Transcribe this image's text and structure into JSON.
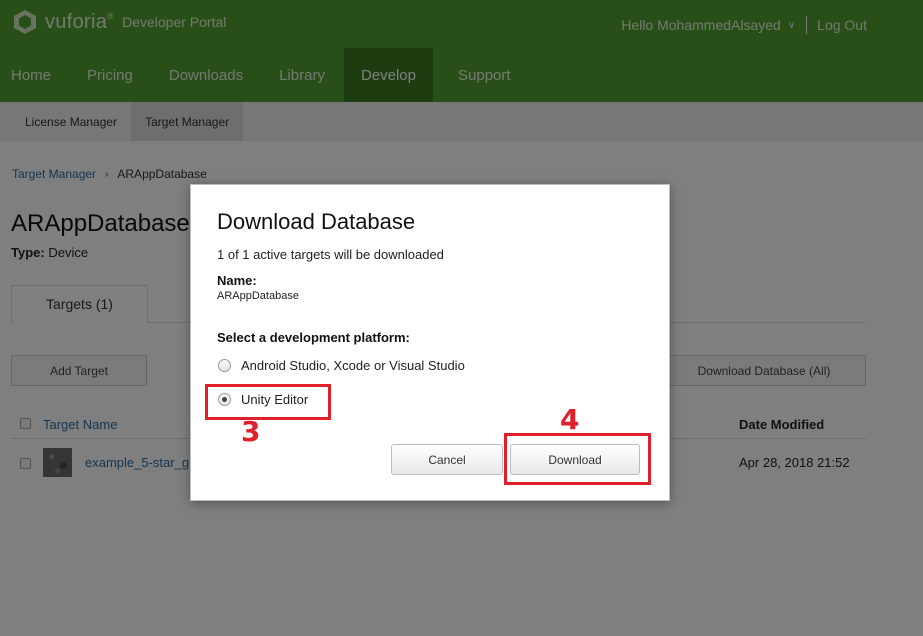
{
  "header": {
    "logo_text": "vuforia",
    "logo_sup": "®",
    "logo_sub": "Developer Portal",
    "greeting": "Hello MohammedAlsayed",
    "logout": "Log Out"
  },
  "nav": {
    "items": [
      {
        "label": "Home"
      },
      {
        "label": "Pricing"
      },
      {
        "label": "Downloads"
      },
      {
        "label": "Library"
      },
      {
        "label": "Develop"
      },
      {
        "label": "Support"
      }
    ],
    "active": "Develop"
  },
  "subnav": {
    "items": [
      {
        "label": "License Manager"
      },
      {
        "label": "Target Manager"
      }
    ],
    "active": "Target Manager"
  },
  "breadcrumb": {
    "root": "Target Manager",
    "separator": "›",
    "current": "ARAppDatabase"
  },
  "page": {
    "title": "ARAppDatabase",
    "type_label": "Type:",
    "type_value": "Device",
    "tab_targets": "Targets (1)",
    "add_target": "Add Target",
    "download_all": "Download Database (All)"
  },
  "table": {
    "col_name": "Target Name",
    "col_date": "Date Modified",
    "rows": [
      {
        "name": "example_5-star_g",
        "date": "Apr 28, 2018 21:52"
      }
    ]
  },
  "modal": {
    "title": "Download Database",
    "info": "1 of 1 active targets will be downloaded",
    "name_label": "Name:",
    "name_value": "ARAppDatabase",
    "select_label": "Select a development platform:",
    "options": [
      {
        "label": "Android Studio, Xcode or Visual Studio",
        "selected": false
      },
      {
        "label": "Unity Editor",
        "selected": true
      }
    ],
    "cancel": "Cancel",
    "download": "Download"
  },
  "annotations": {
    "step3": "3",
    "step4": "4",
    "color": "#e0202a"
  },
  "colors": {
    "brand_green": "#509e2f",
    "active_nav": "#3a7a23",
    "link": "#2b6ea8"
  }
}
